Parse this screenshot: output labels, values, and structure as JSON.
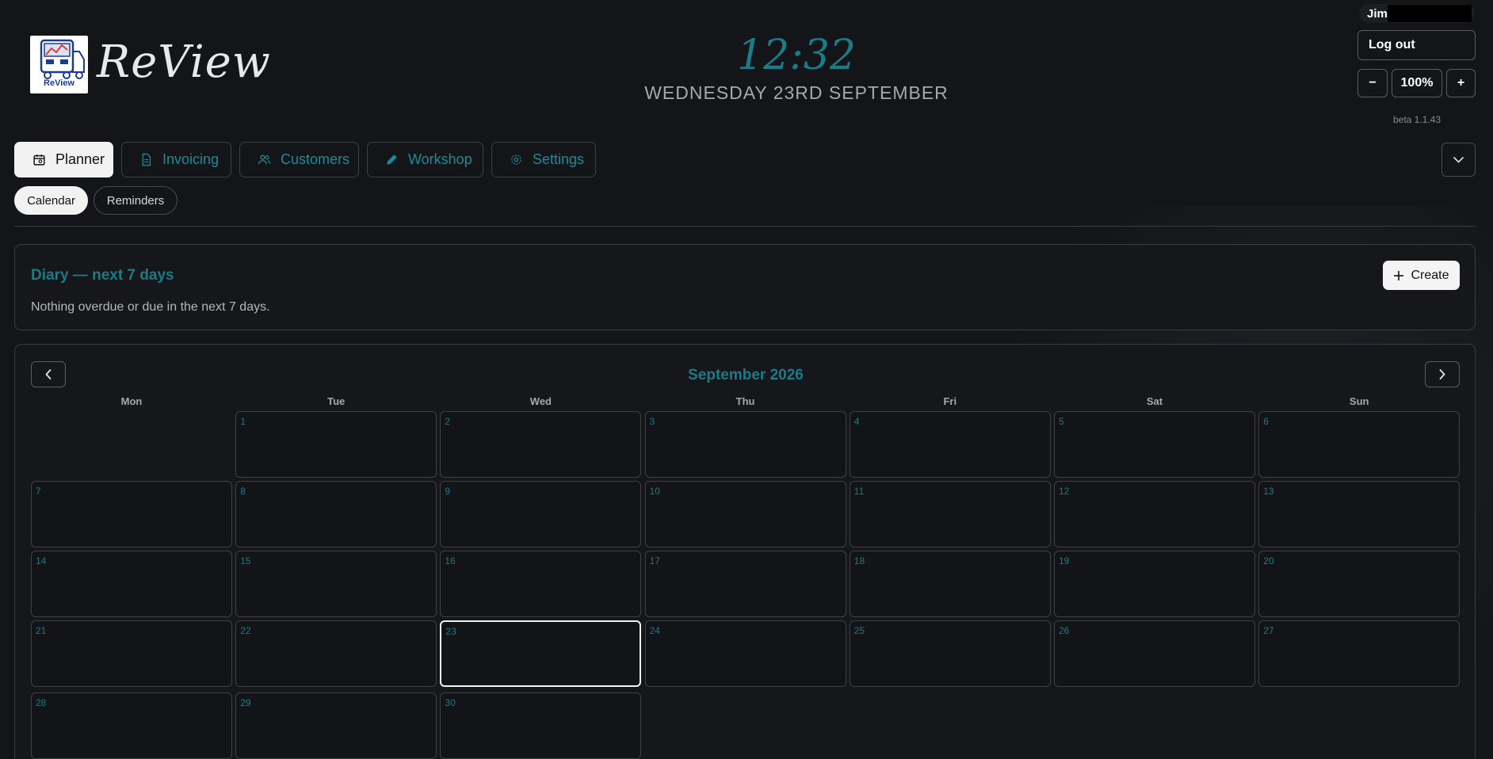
{
  "brand": {
    "name": "ReView",
    "logo_caption": "ReView"
  },
  "header": {
    "time": "12:32",
    "date": "WEDNESDAY 23RD SEPTEMBER"
  },
  "user": {
    "name": "Jim",
    "logout_label": "Log out"
  },
  "zoom": {
    "minus": "−",
    "level": "100%",
    "plus": "+"
  },
  "version": "beta 1.1.43",
  "tabs": [
    {
      "label": "Planner",
      "icon": "calendar-icon",
      "active": true
    },
    {
      "label": "Invoicing",
      "icon": "document-icon",
      "active": false
    },
    {
      "label": "Customers",
      "icon": "users-icon",
      "active": false
    },
    {
      "label": "Workshop",
      "icon": "pencil-icon",
      "active": false
    },
    {
      "label": "Settings",
      "icon": "gear-icon",
      "active": false
    }
  ],
  "subtabs": [
    {
      "label": "Calendar",
      "active": true
    },
    {
      "label": "Reminders",
      "active": false
    }
  ],
  "diary": {
    "title": "Diary — next 7 days",
    "message": "Nothing overdue or due in the next 7 days.",
    "create_label": "Create"
  },
  "calendar": {
    "month": "September 2026",
    "weekdays": [
      "Mon",
      "Tue",
      "Wed",
      "Thu",
      "Fri",
      "Sat",
      "Sun"
    ],
    "first_weekday_index": 1,
    "days_in_month": 30,
    "today": 23
  },
  "colors": {
    "accent": "#1b7b88",
    "background": "#141518"
  }
}
